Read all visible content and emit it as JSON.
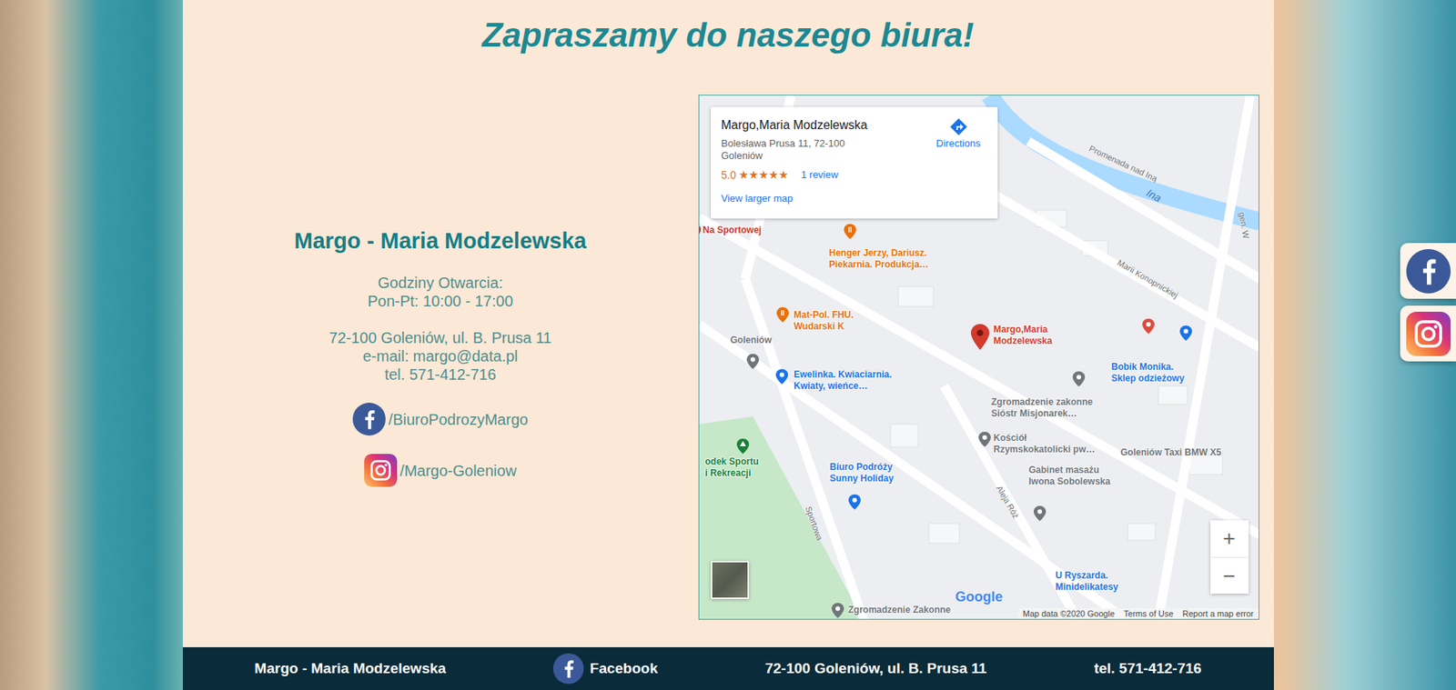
{
  "page": {
    "title": "Zapraszamy do naszego biura!"
  },
  "contact": {
    "name": "Margo - Maria Modzelewska",
    "hours_label": "Godziny Otwarcia:",
    "hours": "Pon-Pt: 10:00 - 17:00",
    "address": "72-100 Goleniów, ul. B. Prusa 11",
    "email": "e-mail: margo@data.pl",
    "phone": "tel. 571-412-716",
    "social": [
      {
        "kind": "facebook",
        "label": "/BiuroPodrozyMargo"
      },
      {
        "kind": "instagram",
        "label": "/Margo-Goleniow"
      }
    ]
  },
  "map": {
    "card": {
      "title": "Margo,Maria Modzelewska",
      "address": "Bolesława Prusa 11, 72-100 Goleniów",
      "rating": "5.0",
      "stars": 5,
      "reviews": "1 review",
      "larger": "View larger map",
      "directions": "Directions"
    },
    "places": [
      {
        "lines": [
          "Na Sportowej"
        ],
        "kind": "food",
        "color": "#d93025"
      },
      {
        "lines": [
          "Henger Jerzy, Dariusz.",
          "Piekarnia. Produkcja…"
        ],
        "kind": "food",
        "color": "#e8710a"
      },
      {
        "lines": [
          "Mat-Pol. FHU.",
          "Wudarski K"
        ],
        "kind": "food",
        "color": "#e8710a"
      },
      {
        "lines": [
          "Margo,Maria",
          "Modzelewska"
        ],
        "kind": "pin",
        "color": "#d23a2e"
      },
      {
        "lines": [],
        "kind": "shop",
        "color": "#e04a3f"
      },
      {
        "lines": [
          "Bobik Monika.",
          "Sklep odzieżowy"
        ],
        "kind": "shop",
        "color": "#1a73e8"
      },
      {
        "lines": [
          "Goleniów"
        ],
        "kind": "place",
        "color": "#70757a"
      },
      {
        "lines": [
          "Ewelinka. Kwiaciarnia.",
          "Kwiaty, wieńce…"
        ],
        "kind": "shop",
        "color": "#1a73e8"
      },
      {
        "lines": [
          "Zgromadzenie zakonne",
          "Sióstr Misjonarek…"
        ],
        "kind": "place",
        "color": "#70757a"
      },
      {
        "lines": [
          "Kościół",
          "Rzymskokatolicki pw…"
        ],
        "kind": "place",
        "color": "#70757a"
      },
      {
        "lines": [
          "Goleniów Taxi BMW X5"
        ],
        "kind": "label",
        "color": "#70757a"
      },
      {
        "lines": [
          "Biuro Podróży",
          "Sunny Holiday"
        ],
        "kind": "shop",
        "color": "#1a73e8"
      },
      {
        "lines": [
          "Gabinet masażu",
          "Iwona Sobolewska"
        ],
        "kind": "place",
        "color": "#70757a"
      },
      {
        "lines": [
          "odek Sportu",
          "i Rekreacji"
        ],
        "kind": "park",
        "color": "#188038"
      },
      {
        "lines": [
          "U Ryszarda.",
          "Minidelikatesy"
        ],
        "kind": "label",
        "color": "#1a73e8"
      },
      {
        "lines": [
          "Zgromadzenie Zakonne"
        ],
        "kind": "place",
        "color": "#70757a"
      }
    ],
    "streets": [
      {
        "text": "Ina",
        "kind": "river"
      },
      {
        "text": "Promenada nad Iną",
        "kind": "road"
      },
      {
        "text": "Marii Konopnickiej",
        "kind": "road"
      },
      {
        "text": "Sportowa",
        "kind": "road"
      },
      {
        "text": "Aleja Róż",
        "kind": "road"
      },
      {
        "text": "gen. W",
        "kind": "road"
      }
    ],
    "zoom": [
      "+",
      "−"
    ],
    "logo": "Google",
    "attribution": [
      "Map data ©2020 Google",
      "Terms of Use",
      "Report a map error"
    ]
  },
  "side_buttons": [
    {
      "kind": "facebook"
    },
    {
      "kind": "instagram"
    }
  ],
  "footer": {
    "name": "Margo - Maria Modzelewska",
    "facebook": "Facebook",
    "address": "72-100 Goleniów, ul. B. Prusa 11",
    "phone": "tel. 571-412-716"
  }
}
